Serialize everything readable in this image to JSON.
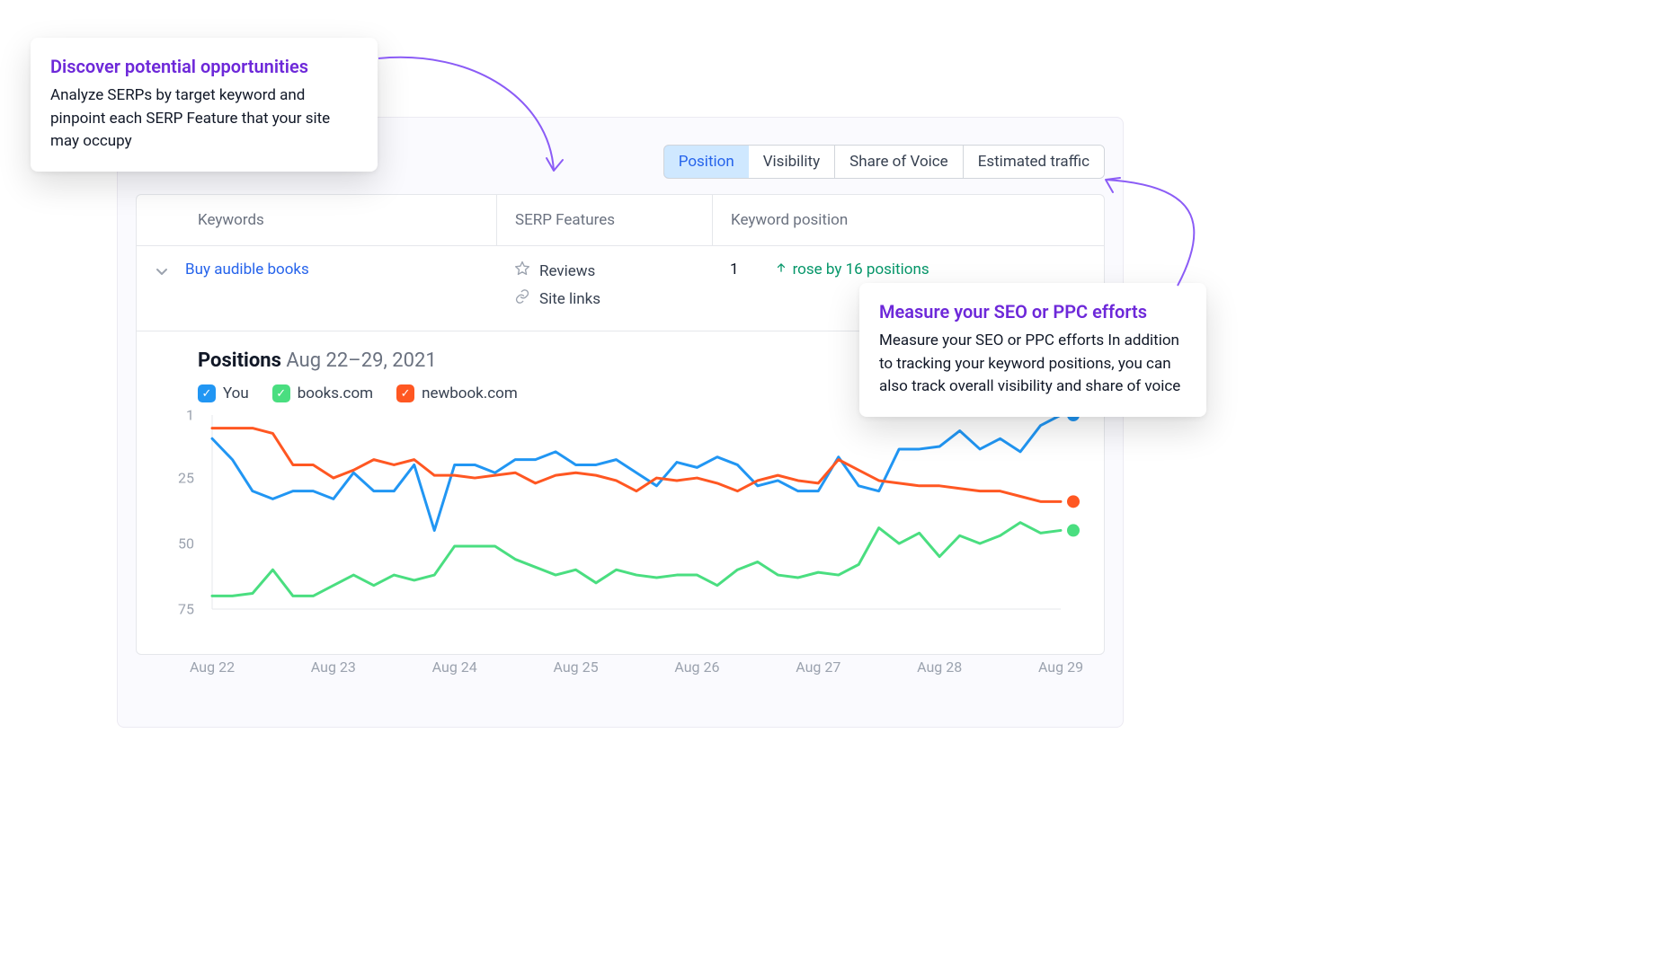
{
  "tabs": [
    "Position",
    "Visibility",
    "Share of Voice",
    "Estimated traffic"
  ],
  "active_tab": 0,
  "columns": {
    "keywords": "Keywords",
    "serp": "SERP Features",
    "pos": "Keyword position"
  },
  "row": {
    "keyword": "Buy audible books",
    "serp": [
      {
        "icon": "star",
        "label": "Reviews"
      },
      {
        "icon": "link",
        "label": "Site links"
      }
    ],
    "position": "1",
    "change": "rose by 16 positions"
  },
  "chart_title_bold": "Positions",
  "chart_title_rest": "Aug 22–29, 2021",
  "legend": [
    {
      "name": "You",
      "color": "#2196f3"
    },
    {
      "name": "books.com",
      "color": "#4ade80"
    },
    {
      "name": "newbook.com",
      "color": "#ff5722"
    }
  ],
  "callout_left": {
    "title": "Discover potential opportunities",
    "body": "Analyze SERPs by target keyword and pinpoint each SERP Feature that your site may occupy"
  },
  "callout_right": {
    "title": "Measure your SEO or PPC efforts",
    "body": "Measure your SEO or PPC efforts In addition to tracking your keyword positions, you can also track overall visibility and share of voice"
  },
  "chart_data": {
    "type": "line",
    "title": "Positions Aug 22–29, 2021",
    "xlabel": "",
    "ylabel": "",
    "ylim": [
      1,
      75
    ],
    "y_reversed": true,
    "y_ticks": [
      1,
      25,
      50,
      75
    ],
    "categories": [
      "Aug 22",
      "",
      "",
      "",
      "",
      "",
      "Aug 23",
      "",
      "",
      "",
      "",
      "",
      "Aug 24",
      "",
      "",
      "",
      "",
      "",
      "Aug 25",
      "",
      "",
      "",
      "",
      "",
      "Aug 26",
      "",
      "",
      "",
      "",
      "",
      "Aug 27",
      "",
      "",
      "",
      "",
      "",
      "Aug 28",
      "",
      "",
      "",
      "",
      "",
      "Aug 29"
    ],
    "x_tick_labels": [
      "Aug 22",
      "Aug 23",
      "Aug 24",
      "Aug 25",
      "Aug 26",
      "Aug 27",
      "Aug 28",
      "Aug 29"
    ],
    "series": [
      {
        "name": "You",
        "color": "#2196f3",
        "values": [
          10,
          18,
          30,
          33,
          30,
          30,
          33,
          23,
          30,
          30,
          20,
          45,
          20,
          20,
          23,
          18,
          18,
          15,
          20,
          20,
          18,
          23,
          28,
          19,
          21,
          17,
          20,
          28,
          26,
          30,
          30,
          17,
          28,
          30,
          14,
          14,
          13,
          7,
          14,
          10,
          15,
          5,
          1
        ]
      },
      {
        "name": "books.com",
        "color": "#4ade80",
        "values": [
          70,
          70,
          69,
          60,
          70,
          70,
          66,
          62,
          66,
          62,
          64,
          62,
          51,
          51,
          51,
          56,
          59,
          62,
          60,
          65,
          60,
          62,
          63,
          62,
          62,
          66,
          60,
          57,
          62,
          63,
          61,
          62,
          58,
          44,
          50,
          46,
          55,
          47,
          50,
          47,
          42,
          46,
          45
        ]
      },
      {
        "name": "newbook.com",
        "color": "#ff5722",
        "values": [
          6,
          6,
          6,
          8,
          20,
          20,
          25,
          22,
          18,
          20,
          18,
          24,
          24,
          25,
          24,
          23,
          27,
          24,
          23,
          24,
          26,
          30,
          25,
          26,
          25,
          27,
          30,
          26,
          24,
          26,
          27,
          18,
          22,
          26,
          27,
          28,
          28,
          29,
          30,
          30,
          32,
          34,
          34
        ]
      }
    ]
  }
}
